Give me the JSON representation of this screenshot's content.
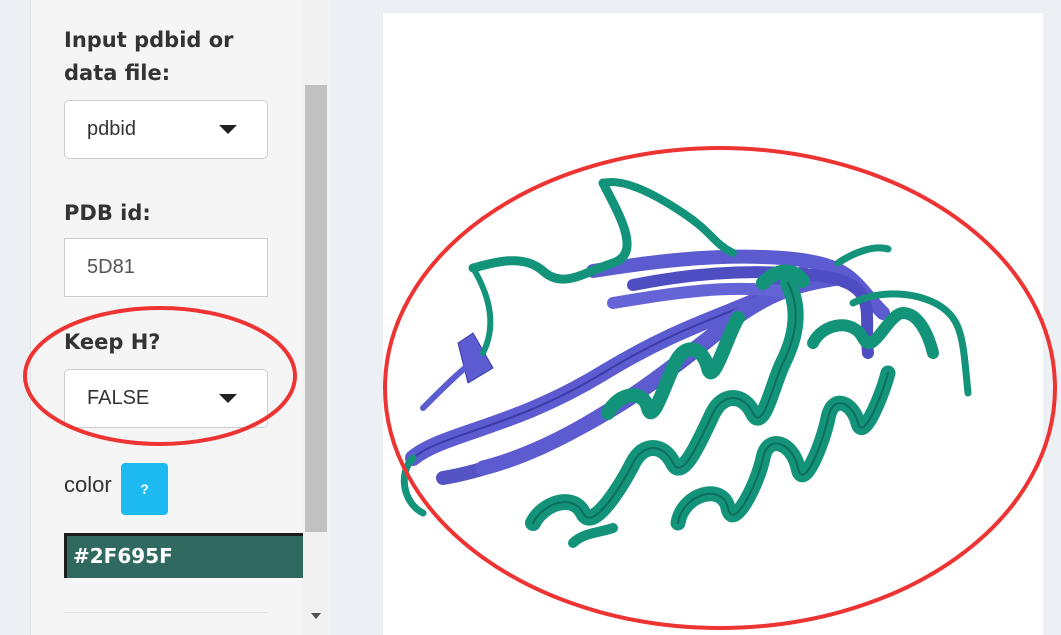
{
  "sidebar": {
    "input_label": "Input pdbid or data file:",
    "input_type": {
      "selected": "pdbid"
    },
    "pdb_id": {
      "label": "PDB id:",
      "value": "5D81"
    },
    "keep_h": {
      "label": "Keep H?",
      "selected": "FALSE"
    },
    "color": {
      "label": "color",
      "help": "?",
      "value": "#2F695F"
    }
  },
  "colors": {
    "helix": "#13937a",
    "sheet": "#5c5cd0",
    "annotation": "#ee3333",
    "help_button": "#1cbaf0"
  }
}
